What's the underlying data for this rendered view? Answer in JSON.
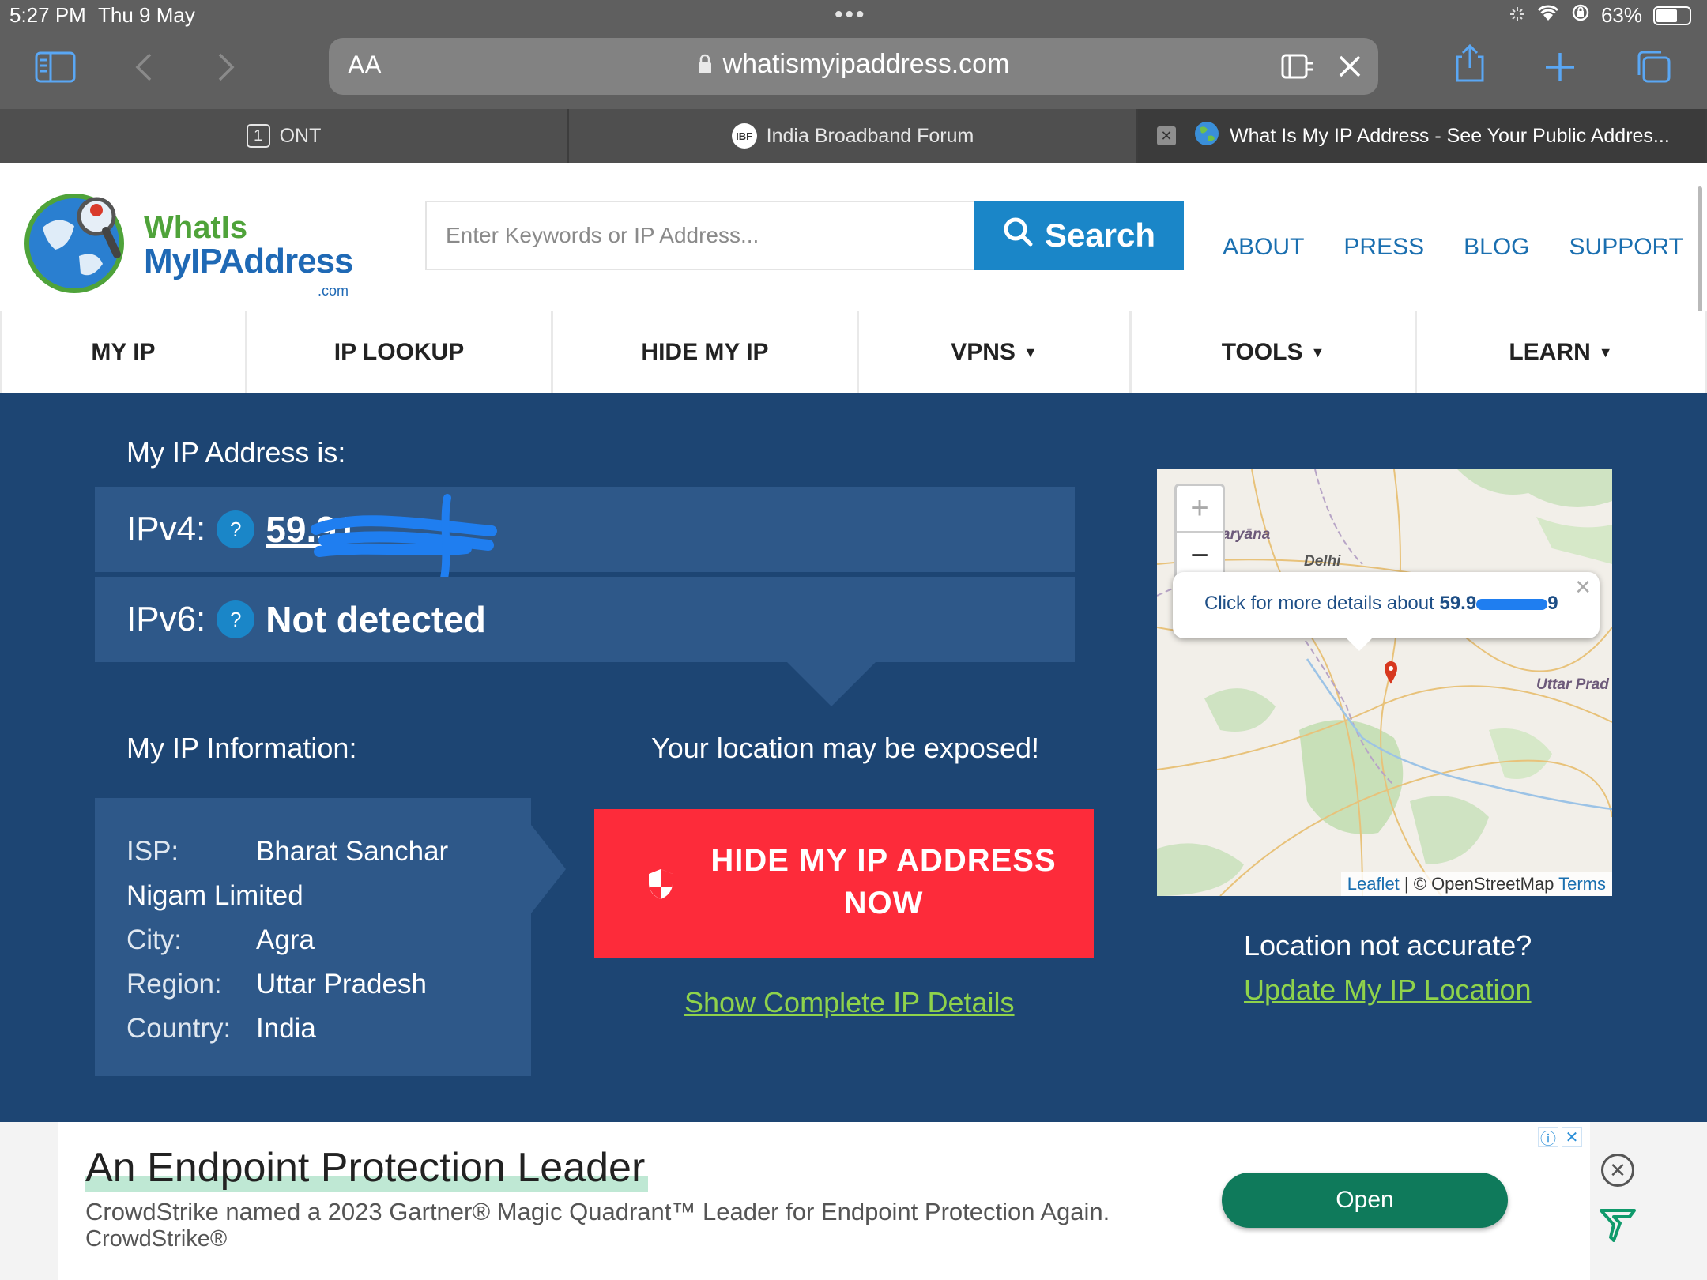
{
  "status": {
    "time": "5:27 PM",
    "date": "Thu 9 May",
    "battery": "63%"
  },
  "browser": {
    "url_aa": "AA",
    "url": "whatismyipaddress.com",
    "tabs": [
      {
        "badge": "1",
        "label": "ONT"
      },
      {
        "badge": "IBF",
        "label": "India Broadband Forum"
      },
      {
        "label": "What Is My IP Address - See Your Public Addres..."
      }
    ]
  },
  "header": {
    "logo_line1": "WhatIs",
    "logo_line2": "MyIPAddress",
    "logo_suffix": ".com",
    "search_placeholder": "Enter Keywords or IP Address...",
    "search_label": "Search",
    "links": [
      "ABOUT",
      "PRESS",
      "BLOG",
      "SUPPORT"
    ]
  },
  "nav": [
    {
      "label": "MY IP"
    },
    {
      "label": "IP LOOKUP"
    },
    {
      "label": "HIDE MY IP"
    },
    {
      "label": "VPNS"
    },
    {
      "label": "TOOLS"
    },
    {
      "label": "LEARN"
    }
  ],
  "ip": {
    "heading": "My IP Address is:",
    "ipv4_label": "IPv4:",
    "ipv4_value": "59.91.",
    "ipv6_label": "IPv6:",
    "ipv6_value": "Not detected",
    "help": "?"
  },
  "info": {
    "heading": "My IP Information:",
    "isp_label": "ISP:",
    "isp_value": "Bharat Sanchar Nigam Limited",
    "city_label": "City:",
    "city_value": "Agra",
    "region_label": "Region:",
    "region_value": "Uttar Pradesh",
    "country_label": "Country:",
    "country_value": "India"
  },
  "cta": {
    "exposed_text": "Your location may be exposed!",
    "hide_line1": "HIDE MY IP ADDRESS",
    "hide_line2": "NOW",
    "details_link": "Show Complete IP Details"
  },
  "map": {
    "zoom_in": "+",
    "zoom_out": "−",
    "popup_text": "Click for more details about ",
    "popup_ip": "59.9",
    "popup_ip_end": "9",
    "label_haryana": "aryāna",
    "label_delhi": "Delhi",
    "label_up": "Uttar Prad",
    "attribution_leaflet": "Leaflet",
    "attribution_osm": "© OpenStreetMap",
    "attribution_terms": "Terms",
    "accuracy_text": "Location not accurate?",
    "update_link": "Update My IP Location"
  },
  "ad": {
    "title": "An Endpoint Protection Leader",
    "description": "CrowdStrike named a 2023 Gartner® Magic Quadrant™ Leader for Endpoint Protection Again.",
    "brand": "CrowdStrike®",
    "button": "Open"
  },
  "colors": {
    "hero_bg": "#1d4573",
    "row_bg": "#2e5889",
    "accent_blue": "#1a86c8",
    "cta_red": "#fd2b3a",
    "link_green": "#8fd34b"
  }
}
